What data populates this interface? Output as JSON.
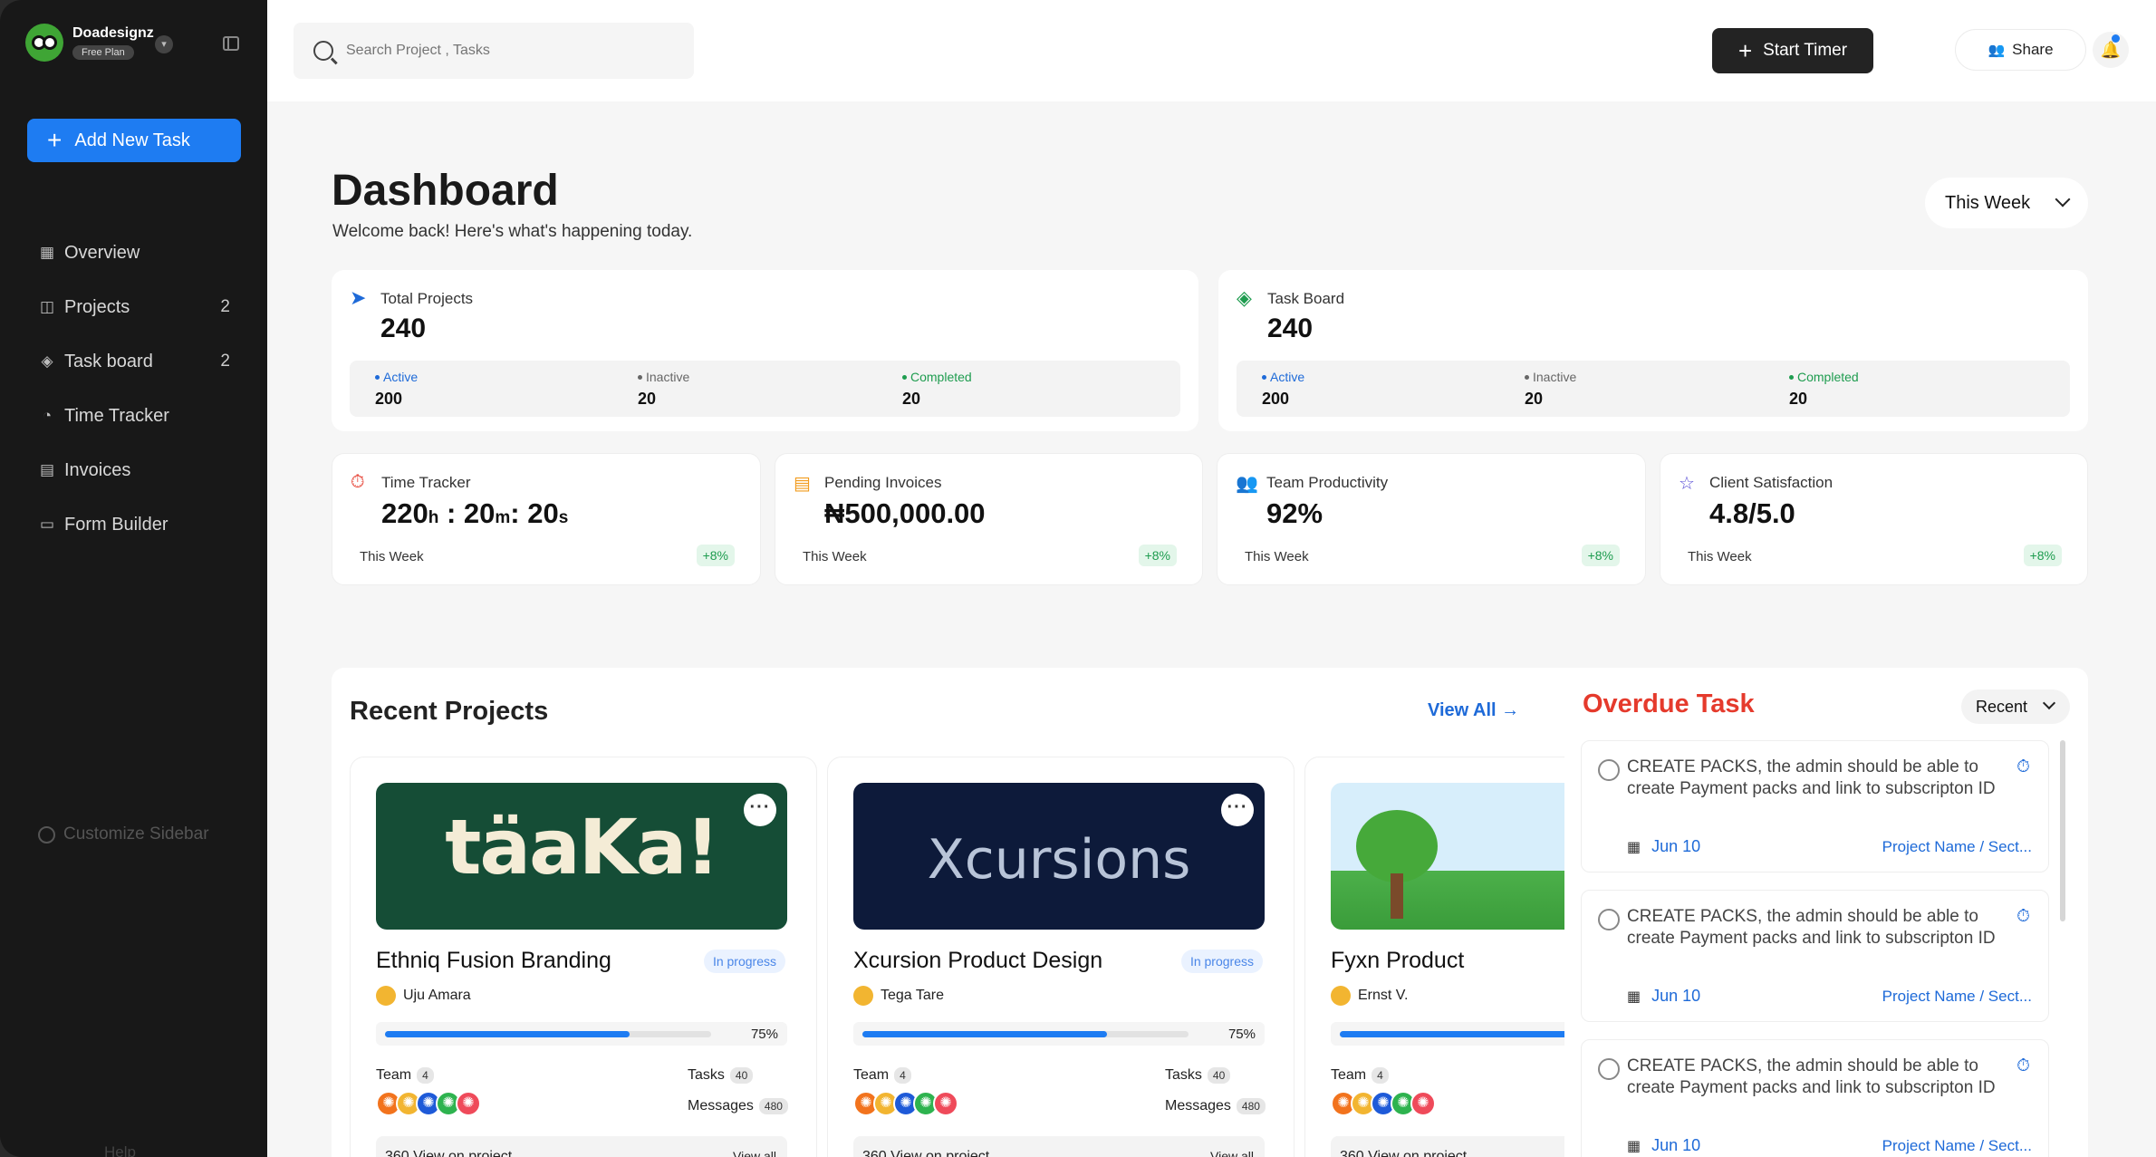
{
  "sidebar": {
    "brand_name": "Doadesignz",
    "plan": "Free Plan",
    "add_task_label": "Add New Task",
    "items": [
      {
        "label": "Overview",
        "count": "",
        "icon": "grid-icon"
      },
      {
        "label": "Projects",
        "count": "2",
        "icon": "folder-icon"
      },
      {
        "label": "Task board",
        "count": "2",
        "icon": "layers-icon"
      },
      {
        "label": "Time Tracker",
        "count": "",
        "icon": "stopwatch-icon"
      },
      {
        "label": "Invoices",
        "count": "",
        "icon": "document-icon"
      },
      {
        "label": "Form Builder",
        "count": "",
        "icon": "folder-open-icon"
      }
    ],
    "customize_label": "Customize Sidebar",
    "help_label": "Help"
  },
  "topbar": {
    "search_placeholder": "Search Project , Tasks",
    "start_timer_label": "Start Timer",
    "share_label": "Share"
  },
  "page": {
    "title": "Dashboard",
    "subtitle": "Welcome back! Here's what's happening today.",
    "range": "This Week"
  },
  "summary": [
    {
      "label": "Total Projects",
      "value": "240",
      "active_label": "Active",
      "active": "200",
      "inactive_label": "Inactive",
      "inactive": "20",
      "completed_label": "Completed",
      "completed": "20"
    },
    {
      "label": "Task Board",
      "value": "240",
      "active_label": "Active",
      "active": "200",
      "inactive_label": "Inactive",
      "inactive": "20",
      "completed_label": "Completed",
      "completed": "20"
    }
  ],
  "metrics": [
    {
      "label": "Time Tracker",
      "h": "220",
      "h_unit": "h",
      "m": "20",
      "m_unit": "m",
      "s": "20",
      "s_unit": "s",
      "period": "This Week",
      "delta": "+8%"
    },
    {
      "label": "Pending Invoices",
      "value": "₦500,000.00",
      "period": "This Week",
      "delta": "+8%"
    },
    {
      "label": "Team Productivity",
      "value": "92%",
      "period": "This Week",
      "delta": "+8%"
    },
    {
      "label": "Client Satisfaction",
      "value": "4.8/5.0",
      "period": "This Week",
      "delta": "+8%"
    }
  ],
  "recent_projects": {
    "title": "Recent Projects",
    "view_all": "View All",
    "items": [
      {
        "banner_text": "täaKa!",
        "name": "Ethniq Fusion Branding",
        "status": "In progress",
        "owner": "Uju Amara",
        "progress": 75,
        "progress_label": "75%",
        "team_label": "Team",
        "team_count": "4",
        "tasks_label": "Tasks",
        "tasks": "40",
        "messages_label": "Messages",
        "messages": "480",
        "foot_left": "360 View on project",
        "foot_right": "View all"
      },
      {
        "banner_text": "Xcursions",
        "name": "Xcursion Product Design",
        "status": "In progress",
        "owner": "Tega Tare",
        "progress": 75,
        "progress_label": "75%",
        "team_label": "Team",
        "team_count": "4",
        "tasks_label": "Tasks",
        "tasks": "40",
        "messages_label": "Messages",
        "messages": "480",
        "foot_left": "360 View on project",
        "foot_right": "View all"
      },
      {
        "banner_text": "",
        "name": "Fyxn Product",
        "status": "",
        "owner": "Ernst V.",
        "progress": 75,
        "progress_label": "",
        "team_label": "Team",
        "team_count": "4",
        "tasks_label": "",
        "tasks": "",
        "messages_label": "",
        "messages": "",
        "foot_left": "360 View on project",
        "foot_right": ""
      }
    ]
  },
  "overdue": {
    "title": "Overdue Task",
    "filter": "Recent",
    "items": [
      {
        "text": "CREATE PACKS, the admin should be able to create Payment packs and link to subscripton ID",
        "date": "Jun 10",
        "project": "Project Name / Sect..."
      },
      {
        "text": "CREATE PACKS, the admin should be able to create Payment packs and link to subscripton ID",
        "date": "Jun 10",
        "project": "Project Name / Sect..."
      },
      {
        "text": "CREATE PACKS, the admin should be able to create Payment packs and link to subscripton ID",
        "date": "Jun 10",
        "project": "Project Name / Sect..."
      }
    ]
  },
  "colors": {
    "accent": "#1e7cf2",
    "sidebar": "#181818",
    "overdue": "#e53a2c",
    "success": "#1e9c4f"
  }
}
